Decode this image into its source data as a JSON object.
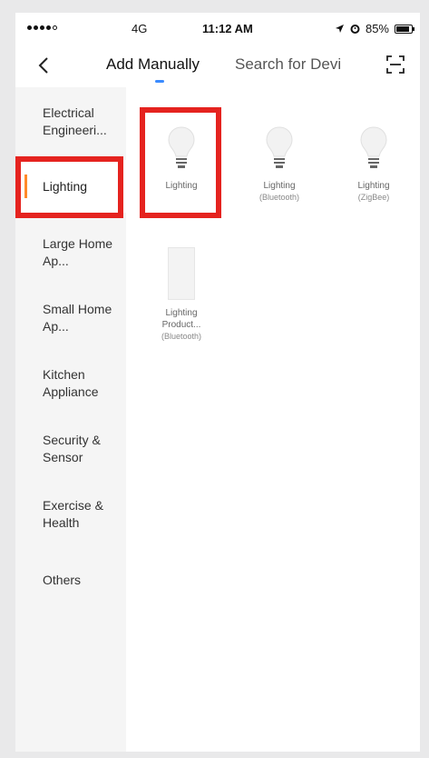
{
  "status_bar": {
    "carrier": "4G",
    "time": "11:12 AM",
    "battery": "85%",
    "battery_level": 0.85
  },
  "nav": {
    "tabs": [
      {
        "label": "Add Manually",
        "active": true
      },
      {
        "label": "Search for Devi",
        "active": false
      }
    ],
    "accent_color": "#3a8bff"
  },
  "sidebar": {
    "accent_color": "#ff8a2a",
    "items": [
      {
        "label": "Electrical Engineeri..."
      },
      {
        "label": "Lighting",
        "selected": true
      },
      {
        "label": "Large Home Ap..."
      },
      {
        "label": "Small Home Ap..."
      },
      {
        "label": "Kitchen Appliance"
      },
      {
        "label": "Security & Sensor"
      },
      {
        "label": "Exercise & Health"
      },
      {
        "label": "Others"
      }
    ]
  },
  "devices": [
    {
      "name": "Lighting",
      "sub": "",
      "icon": "bulb-icon"
    },
    {
      "name": "Lighting",
      "sub": "(Bluetooth)",
      "icon": "bulb-icon"
    },
    {
      "name": "Lighting",
      "sub": "(ZigBee)",
      "icon": "bulb-icon"
    },
    {
      "name": "Lighting Product...",
      "sub": "(Bluetooth)",
      "icon": "panel-icon"
    }
  ],
  "highlight_color": "#e5231f"
}
